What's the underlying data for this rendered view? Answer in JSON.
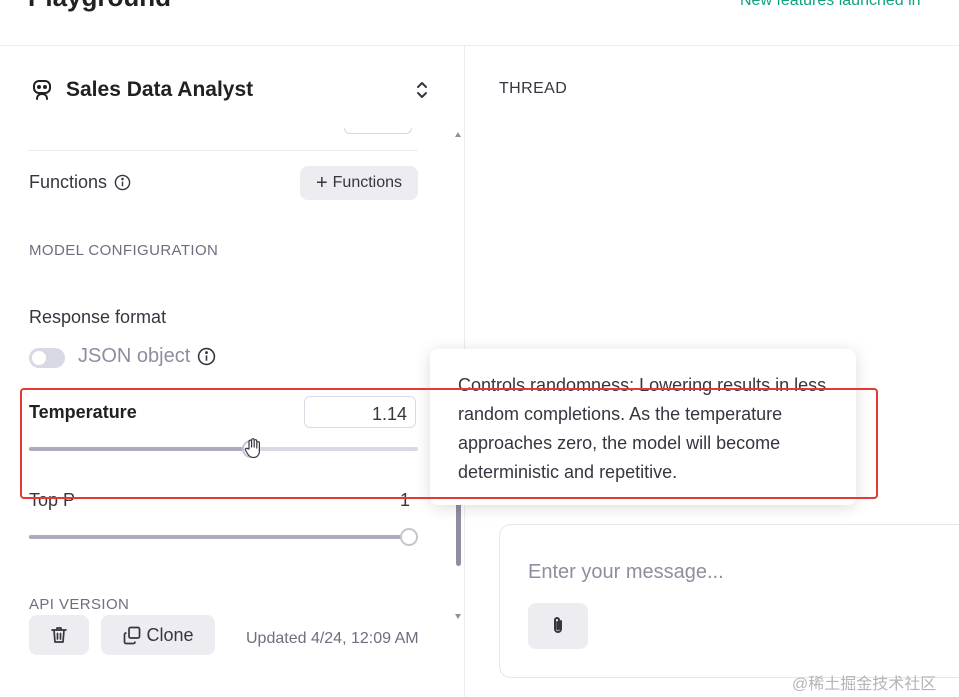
{
  "header": {
    "title": "Playground",
    "announcement": "New features launched in"
  },
  "assistant": {
    "name": "Sales Data Analyst"
  },
  "functions": {
    "label": "Functions",
    "button_label": "Functions"
  },
  "model_config": {
    "section_title": "MODEL CONFIGURATION",
    "response_format": {
      "label": "Response format",
      "toggle_label": "JSON object",
      "toggle_on": false
    },
    "temperature": {
      "label": "Temperature",
      "value": "1.14",
      "level_fraction": 0.57
    },
    "top_p": {
      "label": "Top P",
      "value": "1",
      "level_fraction": 1.0
    }
  },
  "api_version": {
    "section_title": "API VERSION"
  },
  "footer": {
    "clone_label": "Clone",
    "updated_text": "Updated 4/24, 12:09 AM"
  },
  "thread": {
    "label": "THREAD"
  },
  "composer": {
    "placeholder": "Enter your message..."
  },
  "tooltip": {
    "text": "Controls randomness: Lowering results in less random completions. As the temperature approaches zero, the model will become deterministic and repetitive."
  },
  "watermark": "@稀土掘金技术社区",
  "colors": {
    "accent": "#10a37f",
    "highlight": "#e53935"
  },
  "icons": [
    "robot-icon",
    "chevron-updown-icon",
    "info-icon",
    "plus-icon",
    "trash-icon",
    "copy-icon",
    "paperclip-icon",
    "hand-cursor-icon"
  ]
}
